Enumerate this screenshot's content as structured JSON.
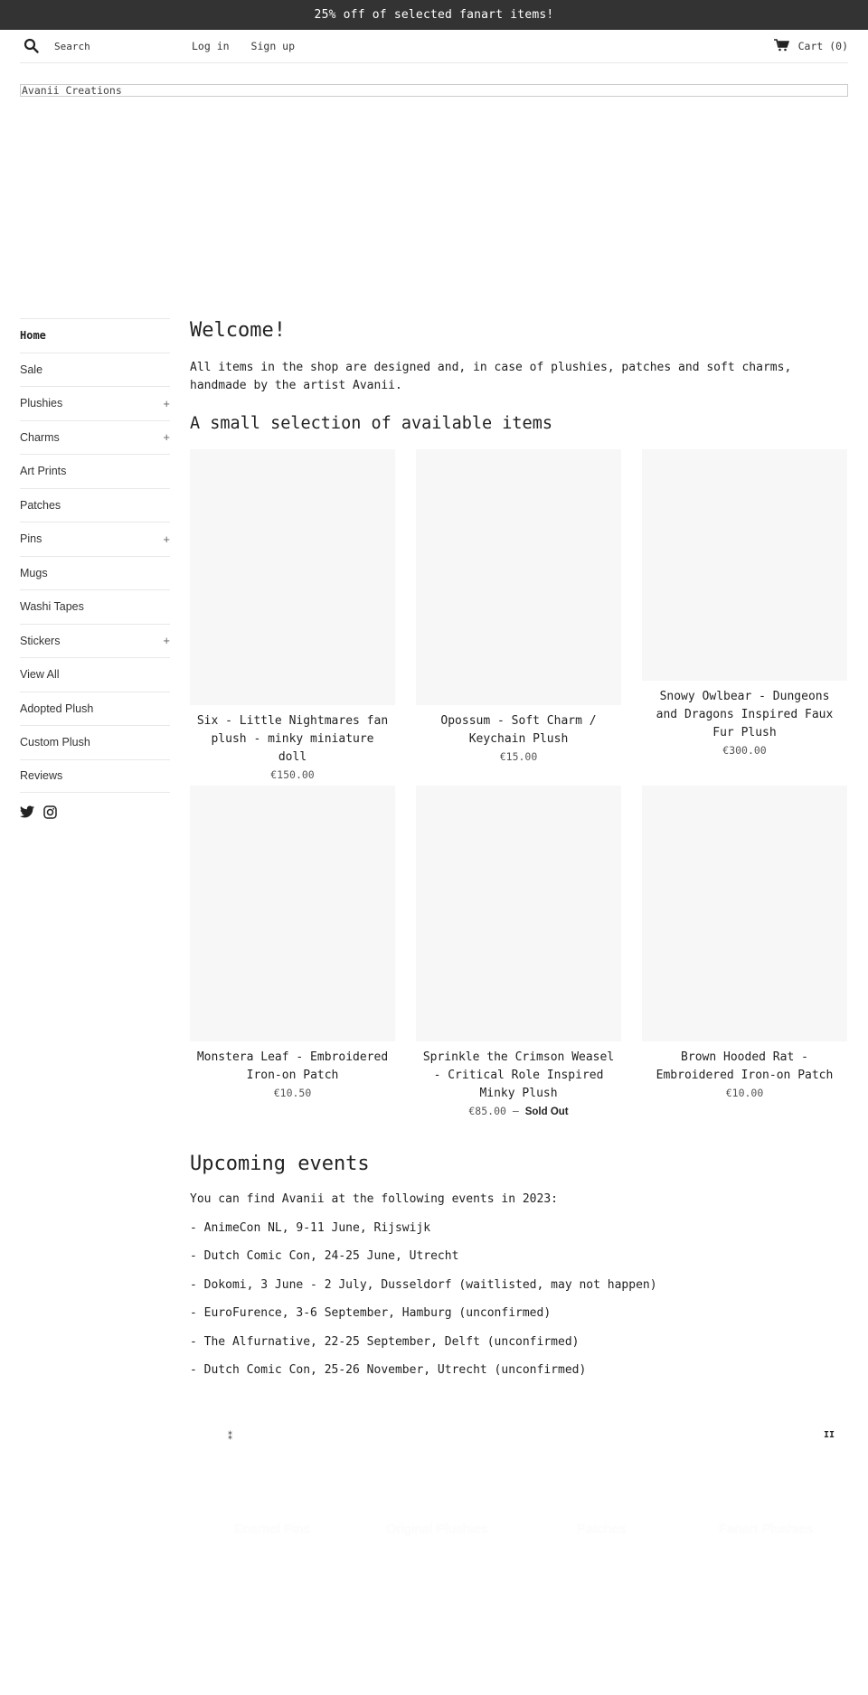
{
  "announcement": "25% off of selected fanart items!",
  "header": {
    "search_placeholder": "Search",
    "login": "Log in",
    "signup": "Sign up",
    "cart": "Cart (0)",
    "logo_alt": "Avanii Creations"
  },
  "sidebar": {
    "items": [
      {
        "label": "Home",
        "expandable": false,
        "active": true
      },
      {
        "label": "Sale",
        "expandable": false
      },
      {
        "label": "Plushies",
        "expandable": true
      },
      {
        "label": "Charms",
        "expandable": true
      },
      {
        "label": "Art Prints",
        "expandable": false
      },
      {
        "label": "Patches",
        "expandable": false
      },
      {
        "label": "Pins",
        "expandable": true
      },
      {
        "label": "Mugs",
        "expandable": false
      },
      {
        "label": "Washi Tapes",
        "expandable": false
      },
      {
        "label": "Stickers",
        "expandable": true
      },
      {
        "label": "View All",
        "expandable": false
      },
      {
        "label": "Adopted Plush",
        "expandable": false
      },
      {
        "label": "Custom Plush",
        "expandable": false
      },
      {
        "label": "Reviews",
        "expandable": false
      }
    ],
    "plus_glyph": "+",
    "social": [
      "twitter-icon",
      "instagram-icon"
    ]
  },
  "main": {
    "welcome_title": "Welcome!",
    "welcome_text": "All items in the shop are designed and, in case of plushies, patches and soft charms, handmade by the artist Avanii.",
    "selection_title": "A small selection of available items",
    "products": [
      {
        "title": "Six - Little Nightmares fan plush - minky miniature doll",
        "price": "€150.00"
      },
      {
        "title": "Opossum - Soft Charm / Keychain Plush",
        "price": "€15.00"
      },
      {
        "title": "Snowy Owlbear - Dungeons and Dragons Inspired Faux Fur Plush",
        "price": "€300.00"
      },
      {
        "title": "Monstera Leaf - Embroidered Iron-on Patch",
        "price": "€10.50"
      },
      {
        "title": "Sprinkle the Crimson Weasel - Critical Role Inspired Minky Plush",
        "price": "€85.00",
        "separator": " — ",
        "status": "Sold Out"
      },
      {
        "title": "Brown Hooded Rat - Embroidered Iron-on Patch",
        "price": "€10.00"
      }
    ]
  },
  "events": {
    "title": "Upcoming events",
    "intro": "You can find Avanii at the following events in 2023:",
    "items": [
      "- AnimeCon NL, 9-11 June, Rijswijk",
      "- Dutch Comic Con, 24-25 June, Utrecht",
      "- Dokomi, 3 June - 2 July, Dusseldorf (waitlisted, may not happen)",
      "- EuroFurence, 3-6 September, Hamburg (unconfirmed)",
      "- The Alfurnative, 22-25 September, Delft (unconfirmed)",
      "- Dutch Comic Con, 25-26 November, Utrecht (unconfirmed)"
    ]
  },
  "slideshow": {
    "prev_glyph": "⁑",
    "pause_glyph": "II",
    "labels": [
      "Enamel Pins",
      "Original Plushies",
      "Patches",
      "Fanart Plushies"
    ]
  },
  "colors": {
    "announcement_bg": "#333333",
    "product_image_bg": "#f7f7f7",
    "divider": "#e8e8e8"
  }
}
